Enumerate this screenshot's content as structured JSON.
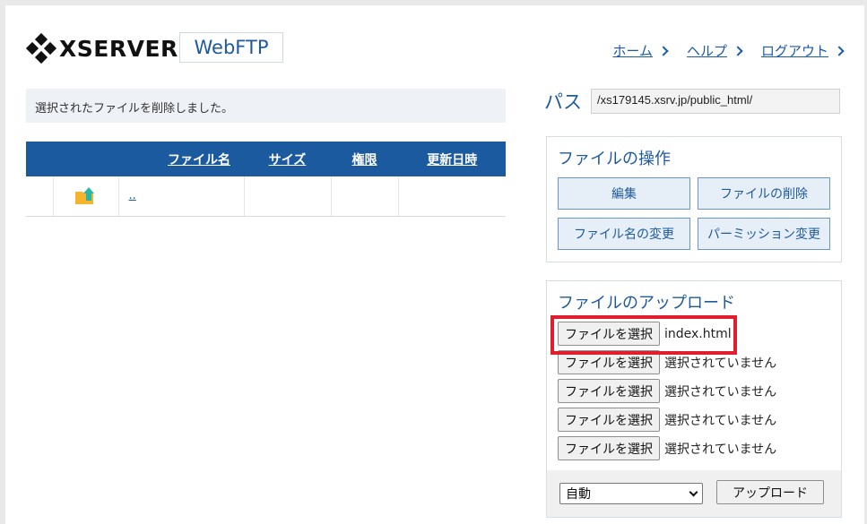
{
  "header": {
    "logo_text": "XSERVER",
    "product": "WebFTP",
    "nav": [
      {
        "label": "ホーム"
      },
      {
        "label": "ヘルプ"
      },
      {
        "label": "ログアウト"
      }
    ]
  },
  "message": "選択されたファイルを削除しました。",
  "file_table": {
    "columns": [
      "ファイル名",
      "サイズ",
      "権限",
      "更新日時"
    ],
    "rows": [
      {
        "name": "..",
        "size": "",
        "permission": "",
        "modified": ""
      }
    ]
  },
  "path": {
    "label": "パス",
    "value": "/xs179145.xsrv.jp/public_html/"
  },
  "file_ops": {
    "title": "ファイルの操作",
    "buttons": [
      "編集",
      "ファイルの削除",
      "ファイル名の変更",
      "パーミッション変更"
    ]
  },
  "upload": {
    "title": "ファイルのアップロード",
    "choose_label": "ファイルを選択",
    "files": [
      "index.html",
      "選択されていません",
      "選択されていません",
      "選択されていません",
      "選択されていません"
    ],
    "encoding": "自動",
    "submit_label": "アップロード"
  },
  "colors": {
    "accent": "#1c5aa0",
    "link": "#1b5aa8",
    "highlight": "#e01e2d",
    "folder_up": "#f4b52d",
    "folder_arrow": "#2bb5a8"
  }
}
